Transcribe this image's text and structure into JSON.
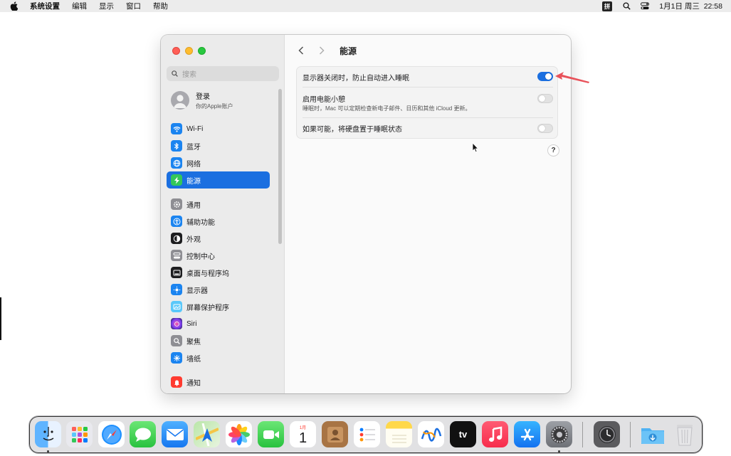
{
  "menubar": {
    "app_name": "系统设置",
    "menus": [
      "编辑",
      "显示",
      "窗口",
      "帮助"
    ],
    "ime": "拼",
    "datetime": "1月1日 周三  22:58"
  },
  "sidebar": {
    "search_placeholder": "搜索",
    "account": {
      "name": "登录",
      "subtitle": "你的Apple账户"
    },
    "items": [
      {
        "label": "Wi-Fi",
        "icon": "wifi-icon",
        "color": "#1b84f0"
      },
      {
        "label": "蓝牙",
        "icon": "bluetooth-icon",
        "color": "#1b84f0"
      },
      {
        "label": "网络",
        "icon": "globe-icon",
        "color": "#1b84f0"
      },
      {
        "label": "能源",
        "icon": "energy-icon",
        "color": "#34c759",
        "active": true
      },
      {
        "label": "通用",
        "icon": "gear-icon",
        "color": "#8e8e93"
      },
      {
        "label": "辅助功能",
        "icon": "accessibility-icon",
        "color": "#1b84f0"
      },
      {
        "label": "外观",
        "icon": "appearance-icon",
        "color": "#1d1d1f"
      },
      {
        "label": "控制中心",
        "icon": "control-center-icon",
        "color": "#8e8e93"
      },
      {
        "label": "桌面与程序坞",
        "icon": "dock-icon",
        "color": "#1d1d1f"
      },
      {
        "label": "显示器",
        "icon": "display-icon",
        "color": "#1b84f0"
      },
      {
        "label": "屏幕保护程序",
        "icon": "screensaver-icon",
        "color": "#5ac8fa"
      },
      {
        "label": "Siri",
        "icon": "siri-icon",
        "color": "#7b3ff2"
      },
      {
        "label": "聚焦",
        "icon": "spotlight-icon",
        "color": "#8e8e93"
      },
      {
        "label": "墙纸",
        "icon": "wallpaper-icon",
        "color": "#1b84f0"
      },
      {
        "label": "通知",
        "icon": "bell-icon",
        "color": "#ff3b30"
      }
    ]
  },
  "content": {
    "title": "能源",
    "settings": [
      {
        "label": "显示器关闭时，防止自动进入睡眠",
        "desc": "",
        "on": true
      },
      {
        "label": "启用电能小憩",
        "desc": "睡眠时，Mac 可以定期检查新电子邮件、日历和其他 iCloud 更新。",
        "on": false
      },
      {
        "label": "如果可能，将硬盘置于睡眠状态",
        "desc": "",
        "on": false
      }
    ],
    "help": "?"
  },
  "dock": {
    "apps": [
      "finder",
      "launchpad",
      "safari",
      "messages",
      "mail",
      "maps",
      "photos",
      "facetime",
      "calendar",
      "contacts",
      "reminders",
      "notes",
      "freeform",
      "tv",
      "music",
      "app-store",
      "system-settings",
      "screen-time",
      "downloads",
      "trash"
    ],
    "calendar_month": "1月",
    "calendar_day": "1",
    "tv_label": "tv"
  },
  "colors": {
    "accent": "#1b6fe0",
    "annotation_arrow": "#e8525a"
  }
}
